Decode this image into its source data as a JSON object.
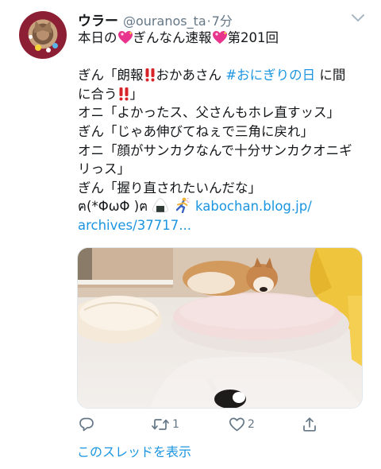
{
  "tweet": {
    "author": {
      "name": "ウラー",
      "handle": "@ouranos_ta",
      "separator": "·",
      "time": "7分"
    },
    "text_lines": {
      "l1_a": "本日の",
      "l1_b": "ぎんなん速報",
      "l1_c": "第201回",
      "l3_a": "ぎん「朗報",
      "l3_b": "おかあさん ",
      "l3_hashtag": "#おにぎりの日",
      "l3_c": " に間",
      "l4_a": "に合う",
      "l4_b": "」",
      "l5": "オニ「よかったス、父さんもホレ直すッス」",
      "l6": "ぎん「じゃあ伸びてねぇで三角に戻れ」",
      "l7": "オニ「顔がサンカクなんで十分サンカクオニギ",
      "l8": "リっス」",
      "l9": "ぎん「握り直されたいんだな」",
      "l10_a": "ฅ(*ΦωΦ )ฅ ",
      "l10_link": "kabochan.blog.jp/",
      "l11_link": "archives/37717..."
    },
    "emoji": [
      "sparkling-heart",
      "double-exclamation",
      "rice-ball",
      "person-running"
    ],
    "actions": {
      "reply_count": "",
      "retweet_count": "1",
      "like_count": "2"
    },
    "thread_link": "このスレッドを表示"
  },
  "colors": {
    "accent": "#1b95e0",
    "secondary": "#657786",
    "text": "#14171a"
  }
}
